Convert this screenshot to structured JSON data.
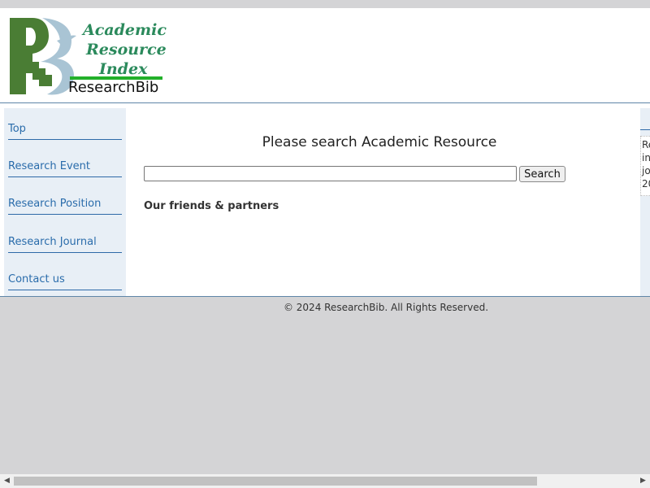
{
  "logo": {
    "line1": "Academic",
    "line2": "Resource",
    "line3": "Index",
    "brand": "ResearchBib"
  },
  "sidebar": {
    "items": [
      {
        "label": "Top"
      },
      {
        "label": "Research Event"
      },
      {
        "label": "Research Position"
      },
      {
        "label": "Research Journal"
      },
      {
        "label": "Contact us"
      }
    ]
  },
  "search": {
    "title": "Please search Academic Resource",
    "input_value": "",
    "placeholder": "",
    "button_label": "Search"
  },
  "friends": {
    "heading": "Our friends & partners"
  },
  "right_panel": {
    "text": "Re\nin\njo\n20"
  },
  "footer": {
    "copyright": "© 2024 ResearchBib. All Rights Reserved."
  },
  "scrollbar": {
    "left_arrow_icon": "triangle-left",
    "right_arrow_icon": "triangle-right"
  },
  "colors": {
    "link": "#2a6cab",
    "logo_green": "#2b8a5c",
    "sidebar_bg": "#e8eff6",
    "page_bg": "#d4d4d6"
  }
}
